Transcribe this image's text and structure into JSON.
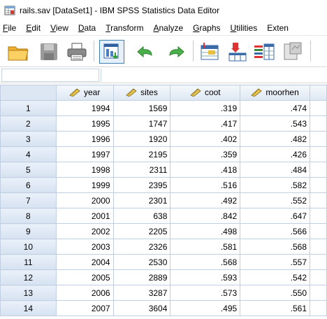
{
  "window": {
    "title": "rails.sav [DataSet1] - IBM SPSS Statistics Data Editor",
    "icon": "spss-app-icon"
  },
  "menu": {
    "items": [
      {
        "mn": "F",
        "rest": "ile"
      },
      {
        "mn": "E",
        "rest": "dit"
      },
      {
        "mn": "V",
        "rest": "iew"
      },
      {
        "mn": "D",
        "rest": "ata"
      },
      {
        "mn": "T",
        "rest": "ransform"
      },
      {
        "mn": "A",
        "rest": "nalyze"
      },
      {
        "mn": "G",
        "rest": "raphs"
      },
      {
        "mn": "U",
        "rest": "tilities"
      },
      {
        "mn": "",
        "rest": "Exten"
      }
    ]
  },
  "toolbar": {
    "buttons": [
      {
        "name": "open-data-icon"
      },
      {
        "name": "save-icon"
      },
      {
        "name": "print-icon"
      },
      {
        "name": "recall-dialog-icon"
      },
      {
        "name": "undo-icon"
      },
      {
        "name": "redo-icon"
      },
      {
        "name": "go-to-case-icon"
      },
      {
        "name": "go-to-variable-icon"
      },
      {
        "name": "variables-icon"
      },
      {
        "name": "run-descriptives-icon"
      }
    ]
  },
  "grid": {
    "columns": [
      "year",
      "sites",
      "coot",
      "moorhen"
    ],
    "column_icon": "scale-measure-icon",
    "rows": [
      {
        "n": "1",
        "year": "1994",
        "sites": "1569",
        "coot": ".319",
        "moorhen": ".474"
      },
      {
        "n": "2",
        "year": "1995",
        "sites": "1747",
        "coot": ".417",
        "moorhen": ".543"
      },
      {
        "n": "3",
        "year": "1996",
        "sites": "1920",
        "coot": ".402",
        "moorhen": ".482"
      },
      {
        "n": "4",
        "year": "1997",
        "sites": "2195",
        "coot": ".359",
        "moorhen": ".426"
      },
      {
        "n": "5",
        "year": "1998",
        "sites": "2311",
        "coot": ".418",
        "moorhen": ".484"
      },
      {
        "n": "6",
        "year": "1999",
        "sites": "2395",
        "coot": ".516",
        "moorhen": ".582"
      },
      {
        "n": "7",
        "year": "2000",
        "sites": "2301",
        "coot": ".492",
        "moorhen": ".552"
      },
      {
        "n": "8",
        "year": "2001",
        "sites": "638",
        "coot": ".842",
        "moorhen": ".647"
      },
      {
        "n": "9",
        "year": "2002",
        "sites": "2205",
        "coot": ".498",
        "moorhen": ".566"
      },
      {
        "n": "10",
        "year": "2003",
        "sites": "2326",
        "coot": ".581",
        "moorhen": ".568"
      },
      {
        "n": "11",
        "year": "2004",
        "sites": "2530",
        "coot": ".568",
        "moorhen": ".557"
      },
      {
        "n": "12",
        "year": "2005",
        "sites": "2889",
        "coot": ".593",
        "moorhen": ".542"
      },
      {
        "n": "13",
        "year": "2006",
        "sites": "3287",
        "coot": ".573",
        "moorhen": ".550"
      },
      {
        "n": "14",
        "year": "2007",
        "sites": "3604",
        "coot": ".495",
        "moorhen": ".561"
      }
    ]
  },
  "colors": {
    "header_bg": "#dde7f3",
    "grid_line": "#c2cfe0"
  }
}
